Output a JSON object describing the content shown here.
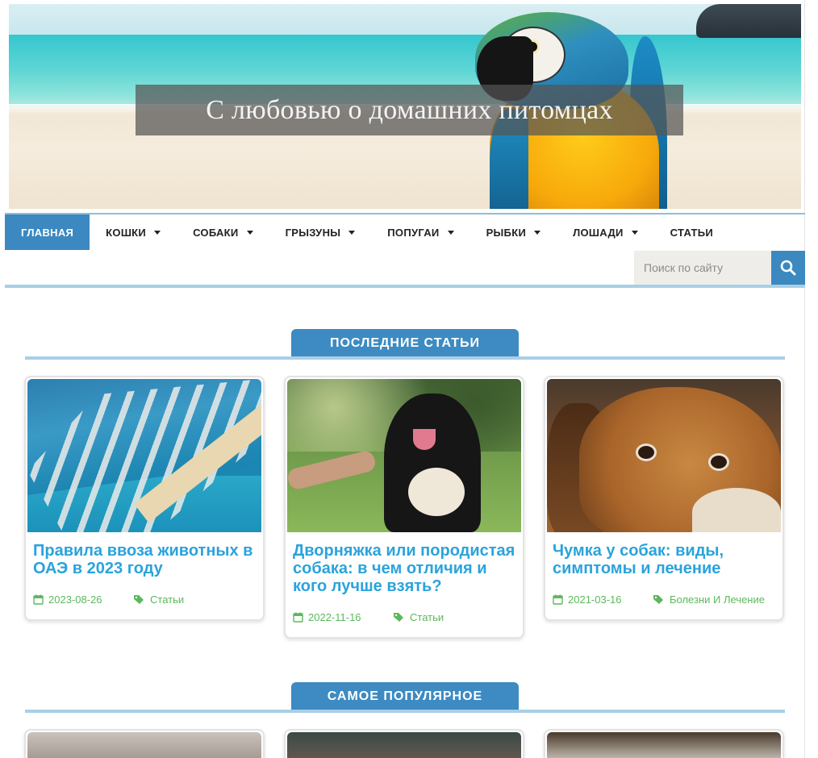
{
  "header": {
    "site_title": "С любовью о домашних питомцах"
  },
  "nav": {
    "items": [
      {
        "label": "ГЛАВНАЯ",
        "active": true,
        "has_dropdown": false
      },
      {
        "label": "КОШКИ",
        "active": false,
        "has_dropdown": true
      },
      {
        "label": "СОБАКИ",
        "active": false,
        "has_dropdown": true
      },
      {
        "label": "ГРЫЗУНЫ",
        "active": false,
        "has_dropdown": true
      },
      {
        "label": "ПОПУГАИ",
        "active": false,
        "has_dropdown": true
      },
      {
        "label": "РЫБКИ",
        "active": false,
        "has_dropdown": true
      },
      {
        "label": "ЛОШАДИ",
        "active": false,
        "has_dropdown": true
      },
      {
        "label": "СТАТЬИ",
        "active": false,
        "has_dropdown": false
      }
    ],
    "search": {
      "placeholder": "Поиск по сайту",
      "value": "",
      "button_icon": "search-icon"
    }
  },
  "latest": {
    "heading": "ПОСЛЕДНИЕ СТАТЬИ",
    "cards": [
      {
        "title": "Правила ввоза животных в ОАЭ в 2023 году",
        "date": "2023-08-26",
        "category": "Статьи",
        "image": "dubai-marina-aerial"
      },
      {
        "title": "Дворняжка или породистая собака: в чем отличия и кого лучше взять?",
        "date": "2022-11-16",
        "category": "Статьи",
        "image": "dog-giving-paw"
      },
      {
        "title": "Чумка у собак: виды, симптомы и лечение",
        "date": "2021-03-16",
        "category": "Болезни И Лечение",
        "image": "sad-beagle"
      }
    ]
  },
  "popular": {
    "heading": "САМОЕ ПОПУЛЯРНОЕ"
  },
  "colors": {
    "accent": "#3b89c0",
    "title_link": "#2aa3dc",
    "meta_green": "#5cb85c",
    "divider": "#a9cfe6"
  }
}
